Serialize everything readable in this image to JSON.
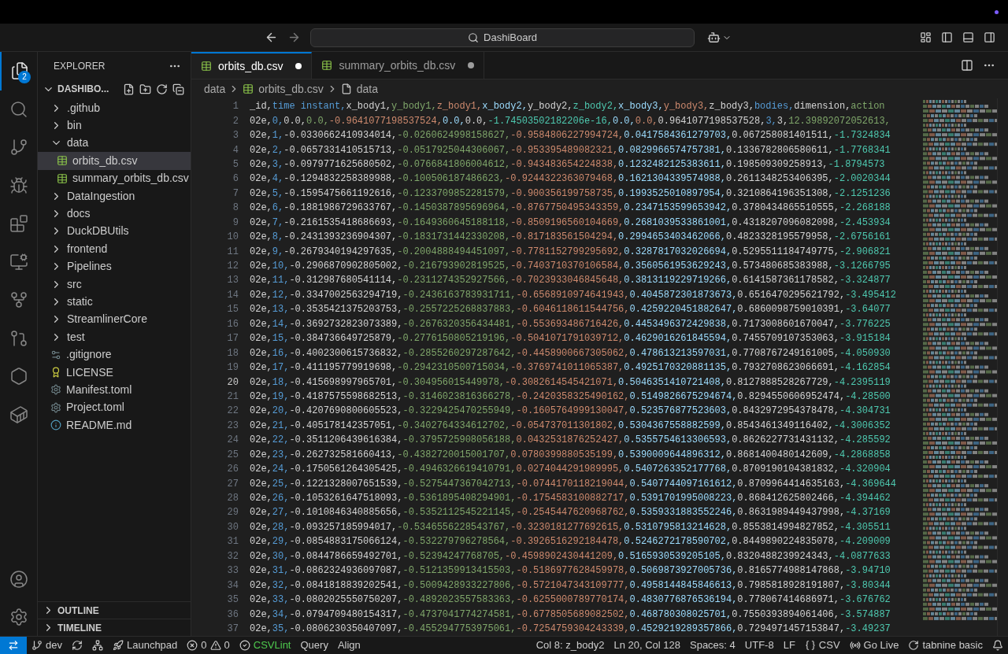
{
  "title_bar": {
    "search": "DashiBoard"
  },
  "activity_bar": {
    "items": [
      {
        "kind": "files",
        "selected": true,
        "badge": "2"
      },
      {
        "kind": "search",
        "selected": false
      },
      {
        "kind": "source-control",
        "selected": false
      },
      {
        "kind": "debug",
        "selected": false
      },
      {
        "kind": "extensions",
        "selected": false
      },
      {
        "kind": "remote",
        "selected": false
      },
      {
        "kind": "git-graph",
        "selected": false
      },
      {
        "kind": "pull-request",
        "selected": false
      },
      {
        "kind": "hexagon",
        "selected": false
      },
      {
        "kind": "docker",
        "selected": false
      }
    ],
    "bottom": [
      {
        "kind": "account"
      },
      {
        "kind": "settings"
      }
    ]
  },
  "sidebar": {
    "title": "EXPLORER",
    "root": "DASHIBO...",
    "items": [
      {
        "label": ".github",
        "kind": "folder",
        "expanded": false,
        "selected": false
      },
      {
        "label": "bin",
        "kind": "folder",
        "expanded": false,
        "selected": false
      },
      {
        "label": "data",
        "kind": "folder",
        "expanded": true,
        "selected": false,
        "children": [
          {
            "label": "orbits_db.csv",
            "kind": "csv",
            "selected": true
          },
          {
            "label": "summary_orbits_db.csv",
            "kind": "csv",
            "selected": false
          }
        ]
      },
      {
        "label": "DataIngestion",
        "kind": "folder",
        "expanded": false,
        "selected": false
      },
      {
        "label": "docs",
        "kind": "folder",
        "expanded": false,
        "selected": false
      },
      {
        "label": "DuckDBUtils",
        "kind": "folder",
        "expanded": false,
        "selected": false
      },
      {
        "label": "frontend",
        "kind": "folder",
        "expanded": false,
        "selected": false
      },
      {
        "label": "Pipelines",
        "kind": "folder",
        "expanded": false,
        "selected": false
      },
      {
        "label": "src",
        "kind": "folder",
        "expanded": false,
        "selected": false
      },
      {
        "label": "static",
        "kind": "folder",
        "expanded": false,
        "selected": false
      },
      {
        "label": "StreamlinerCore",
        "kind": "folder",
        "expanded": false,
        "selected": false
      },
      {
        "label": "test",
        "kind": "folder",
        "expanded": false,
        "selected": false
      },
      {
        "label": ".gitignore",
        "kind": "gitignore",
        "selected": false
      },
      {
        "label": "LICENSE",
        "kind": "license",
        "selected": false
      },
      {
        "label": "Manifest.toml",
        "kind": "toml",
        "selected": false
      },
      {
        "label": "Project.toml",
        "kind": "toml",
        "selected": false
      },
      {
        "label": "README.md",
        "kind": "readme",
        "selected": false
      }
    ],
    "sections": [
      {
        "label": "OUTLINE",
        "expanded": false
      },
      {
        "label": "TIMELINE",
        "expanded": false
      }
    ]
  },
  "tabs": [
    {
      "label": "orbits_db.csv",
      "selected": true,
      "modified": true
    },
    {
      "label": "summary_orbits_db.csv",
      "selected": false,
      "modified": true
    }
  ],
  "breadcrumbs": [
    {
      "label": "data",
      "kind": "folder"
    },
    {
      "label": "orbits_db.csv",
      "kind": "csv"
    },
    {
      "label": "data",
      "kind": "file"
    }
  ],
  "editor": {
    "lines": [
      {
        "number": "1",
        "current": false,
        "cells": [
          "_id,",
          "time instant,",
          "x_body1,",
          "y_body1,",
          "z_body1,",
          "x_body2,",
          "y_body2,",
          "z_body2,",
          "x_body3,",
          "y_body3,",
          "z_body3,",
          "bodies,",
          "dimension,",
          "action"
        ]
      },
      {
        "number": "2",
        "current": false,
        "cells": [
          "02e,",
          "0,",
          "0.0,",
          "0.0,",
          "-0.9641077198537524,",
          "0.0,",
          "0.0,",
          "-1.74503502182206e-16,",
          "0.0,",
          "0.0,",
          "0.9641077198537528,",
          "3,",
          "3,",
          "12.39892072052613,"
        ]
      },
      {
        "number": "3",
        "current": false,
        "cells": [
          "02e,",
          "1,",
          "-0.0330662410934014,",
          "-0.0260624998158627,",
          "-0.9584806227994724,",
          "0.0417584361279703,",
          "0.067258081401511,",
          "-1.7324834"
        ]
      },
      {
        "number": "4",
        "current": false,
        "cells": [
          "02e,",
          "2,",
          "-0.0657331410515713,",
          "-0.0517925044306067,",
          "-0.953395489082321,",
          "0.0829966574757381,",
          "0.1336782806580611,",
          "-1.7768341"
        ]
      },
      {
        "number": "5",
        "current": false,
        "cells": [
          "02e,",
          "3,",
          "-0.0979771625680502,",
          "-0.0766841806004612,",
          "-0.943483654224838,",
          "0.1232482125383611,",
          "0.198509309258913,",
          "-1.8794573"
        ]
      },
      {
        "number": "6",
        "current": false,
        "cells": [
          "02e,",
          "4,",
          "-0.1294832258389988,",
          "-0.100506187486623,",
          "-0.9244322363079468,",
          "0.1621304339574988,",
          "0.2611348253406395,",
          "-2.0020344"
        ]
      },
      {
        "number": "7",
        "current": false,
        "cells": [
          "02e,",
          "5,",
          "-0.1595475661192616,",
          "-0.1233709852281579,",
          "-0.900356199758735,",
          "0.1993525010897954,",
          "0.3210864196351308,",
          "-2.1251236"
        ]
      },
      {
        "number": "8",
        "current": false,
        "cells": [
          "02e,",
          "6,",
          "-0.1881986729633767,",
          "-0.1450387895696964,",
          "-0.8767750495343359,",
          "0.2347153599653942,",
          "0.3780434865510555,",
          "-2.268188"
        ]
      },
      {
        "number": "9",
        "current": false,
        "cells": [
          "02e,",
          "7,",
          "-0.2161535418686693,",
          "-0.1649360645188118,",
          "-0.8509196560104669,",
          "0.2681039533861001,",
          "0.4318207096082098,",
          "-2.453934"
        ]
      },
      {
        "number": "10",
        "current": false,
        "cells": [
          "02e,",
          "8,",
          "-0.2431393236904307,",
          "-0.1831731442330208,",
          "-0.817183561504294,",
          "0.2994653403462066,",
          "0.4823328195579958,",
          "-2.6756161"
        ]
      },
      {
        "number": "11",
        "current": false,
        "cells": [
          "02e,",
          "9,",
          "-0.2679340194297635,",
          "-0.2004888494451097,",
          "-0.7781152799295692,",
          "0.3287817032026694,",
          "0.5295511184749775,",
          "-2.906821"
        ]
      },
      {
        "number": "12",
        "current": false,
        "cells": [
          "02e,",
          "10,",
          "-0.2906870902805002,",
          "-0.216793902819525,",
          "-0.7403710370106584,",
          "0.3560561953629243,",
          "0.573480685383988,",
          "-3.1266795"
        ]
      },
      {
        "number": "13",
        "current": false,
        "cells": [
          "02e,",
          "11,",
          "-0.312987680541114,",
          "-0.2311274352927566,",
          "-0.7023933046845648,",
          "0.3813119229719266,",
          "0.6141587361178582,",
          "-3.324877"
        ]
      },
      {
        "number": "14",
        "current": false,
        "cells": [
          "02e,",
          "12,",
          "-0.3347002563294719,",
          "-0.2436163783931711,",
          "-0.6568910974641943,",
          "0.4045872301873673,",
          "0.6516470295621792,",
          "-3.495412"
        ]
      },
      {
        "number": "15",
        "current": false,
        "cells": [
          "02e,",
          "13,",
          "-0.3535421375203753,",
          "-0.2557225268837883,",
          "-0.6046118611544756,",
          "0.4259220451882647,",
          "0.6860098759010391,",
          "-3.64077"
        ]
      },
      {
        "number": "16",
        "current": false,
        "cells": [
          "02e,",
          "14,",
          "-0.3692732823073389,",
          "-0.2676320356434481,",
          "-0.553693486716426,",
          "0.4453496372429838,",
          "0.7173008601670047,",
          "-3.776225"
        ]
      },
      {
        "number": "17",
        "current": false,
        "cells": [
          "02e,",
          "15,",
          "-0.384736649725879,",
          "-0.2776150805219196,",
          "-0.5041071791039712,",
          "0.4629016261845594,",
          "0.7455709107353063,",
          "-3.915184"
        ]
      },
      {
        "number": "18",
        "current": false,
        "cells": [
          "02e,",
          "16,",
          "-0.4002300615736832,",
          "-0.2855260297287642,",
          "-0.4458900667305062,",
          "0.478613213597031,",
          "0.7708767249161005,",
          "-4.050930"
        ]
      },
      {
        "number": "19",
        "current": false,
        "cells": [
          "02e,",
          "17,",
          "-0.411195779919698,",
          "-0.2942310500715034,",
          "-0.3769741011065387,",
          "0.4925170320881135,",
          "0.7932708623066691,",
          "-4.162854"
        ]
      },
      {
        "number": "20",
        "current": true,
        "cells": [
          "02e,",
          "18,",
          "-0.415698997965701,",
          "-0.304956015449978,",
          "-0.3082614545421071,",
          "0.5046351410721408,",
          "0.8127888528267729,",
          "-4.2395119"
        ]
      },
      {
        "number": "21",
        "current": false,
        "cells": [
          "02e,",
          "19,",
          "-0.4187575598682513,",
          "-0.3146023816366278,",
          "-0.2420358325490162,",
          "0.5149826675294674,",
          "0.8294550606952474,",
          "-4.28500"
        ]
      },
      {
        "number": "22",
        "current": false,
        "cells": [
          "02e,",
          "20,",
          "-0.4207690800605523,",
          "-0.3229425470255949,",
          "-0.1605764999130047,",
          "0.523576877523603,",
          "0.8432972954378478,",
          "-4.304731"
        ]
      },
      {
        "number": "23",
        "current": false,
        "cells": [
          "02e,",
          "21,",
          "-0.405178142357051,",
          "-0.3402764334612702,",
          "-0.054737011301802,",
          "0.5304367558882599,",
          "0.8543461349116402,",
          "-4.3006352"
        ]
      },
      {
        "number": "24",
        "current": false,
        "cells": [
          "02e,",
          "22,",
          "-0.3511206439616384,",
          "-0.3795725908056188,",
          "0.0432531876252427,",
          "0.5355754613306593,",
          "0.8626227731431132,",
          "-4.285592"
        ]
      },
      {
        "number": "25",
        "current": false,
        "cells": [
          "02e,",
          "23,",
          "-0.262732581660413,",
          "-0.4382720015001707,",
          "0.0780399880535199,",
          "0.5390009644896312,",
          "0.8681400480142609,",
          "-4.2868858"
        ]
      },
      {
        "number": "26",
        "current": false,
        "cells": [
          "02e,",
          "24,",
          "-0.1750561264305425,",
          "-0.4946326619410791,",
          "0.0274044291989995,",
          "0.5407263352177768,",
          "0.8709190104381832,",
          "-4.320904"
        ]
      },
      {
        "number": "27",
        "current": false,
        "cells": [
          "02e,",
          "25,",
          "-0.1221328007651539,",
          "-0.5275447367042713,",
          "-0.0744170118219044,",
          "0.5407744097161612,",
          "0.8709964414635163,",
          "-4.369644"
        ]
      },
      {
        "number": "28",
        "current": false,
        "cells": [
          "02e,",
          "26,",
          "-0.1053261647518093,",
          "-0.5361895408294901,",
          "-0.1754583100882717,",
          "0.5391701995008223,",
          "0.868412625802466,",
          "-4.394462"
        ]
      },
      {
        "number": "29",
        "current": false,
        "cells": [
          "02e,",
          "27,",
          "-0.1010846340885656,",
          "-0.5352112545221145,",
          "-0.2545447620968762,",
          "0.5359331883552246,",
          "0.8631989449437998,",
          "-4.37169"
        ]
      },
      {
        "number": "30",
        "current": false,
        "cells": [
          "02e,",
          "28,",
          "-0.093257185994017,",
          "-0.5346556228543767,",
          "-0.3230181277692615,",
          "0.5310795813214628,",
          "0.8553814994827852,",
          "-4.305511"
        ]
      },
      {
        "number": "31",
        "current": false,
        "cells": [
          "02e,",
          "29,",
          "-0.0854883175066124,",
          "-0.532279796278564,",
          "-0.3926516292184478,",
          "0.5246272178590702,",
          "0.8449890224835078,",
          "-4.209009"
        ]
      },
      {
        "number": "32",
        "current": false,
        "cells": [
          "02e,",
          "30,",
          "-0.0844786659492701,",
          "-0.52394247768705,",
          "-0.4598902430441209,",
          "0.5165930539205105,",
          "0.8320488239924343,",
          "-4.0877633"
        ]
      },
      {
        "number": "33",
        "current": false,
        "cells": [
          "02e,",
          "31,",
          "-0.0862324936097087,",
          "-0.5121359913415503,",
          "-0.5186977628459978,",
          "0.5069873927005736,",
          "0.8165774988147868,",
          "-3.94710"
        ]
      },
      {
        "number": "34",
        "current": false,
        "cells": [
          "02e,",
          "32,",
          "-0.0841818839202541,",
          "-0.5009428933227806,",
          "-0.5721047343109777,",
          "0.4958144845846613,",
          "0.7985818928191807,",
          "-3.80344"
        ]
      },
      {
        "number": "35",
        "current": false,
        "cells": [
          "02e,",
          "33,",
          "-0.0802025550750207,",
          "-0.4892023557583363,",
          "-0.6255000789770174,",
          "0.4830776876536194,",
          "0.778067414686971,",
          "-3.676762"
        ]
      },
      {
        "number": "36",
        "current": false,
        "cells": [
          "02e,",
          "34,",
          "-0.0794709480154317,",
          "-0.4737041774274581,",
          "-0.6778505689082502,",
          "0.468780308025701,",
          "0.7550393894061406,",
          "-3.574887"
        ]
      },
      {
        "number": "37",
        "current": false,
        "cells": [
          "02e,",
          "35,",
          "-0.0806230350407097,",
          "-0.4552947753975061,",
          "-0.7254759304243339,",
          "0.4529219289357866,",
          "0.7294971457153847,",
          "-3.49237"
        ]
      }
    ]
  },
  "status_bar": {
    "left": [
      {
        "kind": "branch",
        "label": "dev"
      },
      {
        "kind": "sync"
      },
      {
        "kind": "graph"
      },
      {
        "kind": "launchpad",
        "label": "Launchpad"
      },
      {
        "kind": "problems",
        "errors": "0",
        "warnings": "0"
      },
      {
        "kind": "check",
        "label": "CSVLint"
      },
      {
        "kind": "plain",
        "label": "Query"
      },
      {
        "kind": "plain",
        "label": "Align"
      }
    ],
    "right": [
      {
        "kind": "plain",
        "label": "Col 8: z_body2"
      },
      {
        "kind": "plain",
        "label": "Ln 20, Col 128"
      },
      {
        "kind": "plain",
        "label": "Spaces: 4"
      },
      {
        "kind": "plain",
        "label": "UTF-8"
      },
      {
        "kind": "plain",
        "label": "LF"
      },
      {
        "kind": "braces",
        "label": "CSV"
      },
      {
        "kind": "broadcast",
        "label": "Go Live"
      },
      {
        "kind": "tabnine",
        "label": "tabnine basic"
      },
      {
        "kind": "bell"
      }
    ]
  }
}
